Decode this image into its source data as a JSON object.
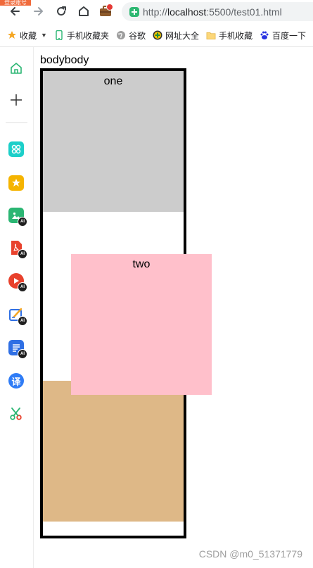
{
  "browser": {
    "corner_badge": "登录账号",
    "url_scheme": "http://",
    "url_host": "localhost",
    "url_rest": ":5500/test01.html"
  },
  "bookmarks": {
    "items": [
      {
        "label": "收藏",
        "icon": "star-icon",
        "has_caret": true
      },
      {
        "label": "手机收藏夹",
        "icon": "phone-icon"
      },
      {
        "label": "谷歌",
        "icon": "globe-icon"
      },
      {
        "label": "网址大全",
        "icon": "web-directory-icon"
      },
      {
        "label": "手机收藏",
        "icon": "folder-icon"
      },
      {
        "label": "百度一下",
        "icon": "baidu-paw-icon"
      }
    ]
  },
  "sidebar": {
    "items": [
      {
        "name": "home",
        "icon": "home-icon"
      },
      {
        "name": "add",
        "icon": "plus-icon"
      },
      {
        "name": "apps",
        "icon": "apps-icon",
        "color": "#1ccfc9"
      },
      {
        "name": "favorites",
        "icon": "star-tile-icon",
        "color": "#f5b400"
      },
      {
        "name": "ai-image",
        "icon": "image-ai-icon",
        "color": "#2bb673"
      },
      {
        "name": "ai-pdf",
        "icon": "pdf-ai-icon",
        "color": "#e8412c"
      },
      {
        "name": "ai-video",
        "icon": "video-ai-icon",
        "color": "#e8412c"
      },
      {
        "name": "ai-write",
        "icon": "write-ai-icon",
        "color": "#2f6fe4"
      },
      {
        "name": "ai-doc",
        "icon": "doc-ai-icon",
        "color": "#2f6fe4"
      },
      {
        "name": "translate",
        "icon": "translate-icon",
        "color": "#2f7cf6",
        "label": "译"
      },
      {
        "name": "screenshot",
        "icon": "scissors-icon",
        "color": "#2bb673"
      }
    ],
    "ai_badge": "AI"
  },
  "page": {
    "label": "bodybody",
    "boxes": {
      "one": "one",
      "two": "two",
      "three": ""
    },
    "colors": {
      "one": "#cccccc",
      "two": "#ffc0cb",
      "three": "#deb887",
      "border": "#000000"
    }
  },
  "watermark": "CSDN @m0_51371779"
}
